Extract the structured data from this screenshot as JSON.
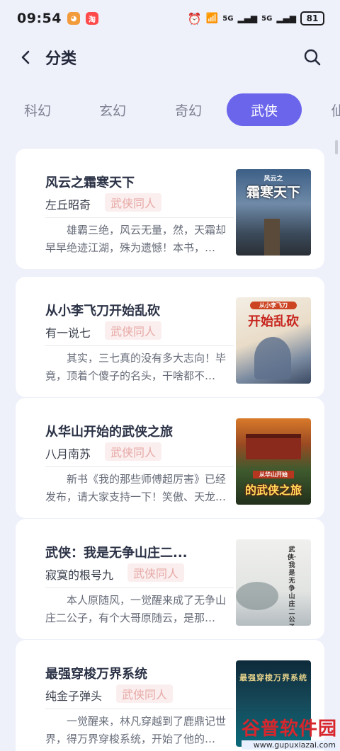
{
  "status_bar": {
    "time": "09:54",
    "sig1": "5G",
    "sig2": "5G",
    "battery": "81"
  },
  "header": {
    "title": "分类"
  },
  "tabs": [
    "科幻",
    "玄幻",
    "奇幻",
    "武侠",
    "仙"
  ],
  "active_tab": "武侠",
  "books": [
    {
      "title": "风云之霜寒天下",
      "author": "左丘昭奇",
      "tag": "武侠同人",
      "desc": "雄霸三绝，风云无量，然，天霜却早早绝迹江湖，殊为遗憾！本书，…",
      "cover_text": "霜寒天下",
      "cover_top": "风云之"
    },
    {
      "title": "从小李飞刀开始乱砍",
      "author": "有一说七",
      "tag": "武侠同人",
      "desc": "其实，三七真的没有多大志向！毕竟，顶着个傻子的名头，干啥都不…",
      "cover_text": "开始乱砍",
      "cover_top": "从小李飞刀"
    },
    {
      "title": "从华山开始的武侠之旅",
      "author": "八月南苏",
      "tag": "武侠同人",
      "desc": "新书《我的那些师傅超厉害》已经发布，请大家支持一下！笑傲、天龙…",
      "cover_text": "的武侠之旅",
      "cover_top": "从华山开始"
    },
    {
      "title": "武侠：我是无争山庄二...",
      "author": "寂寞的根号九",
      "tag": "武侠同人",
      "desc": "本人原随风，一觉醒来成了无争山庄二公子，有个大哥原随云，是那…",
      "cover_text": "武侠·我是无争山庄二公子",
      "cover_top": ""
    },
    {
      "title": "最强穿梭万界系统",
      "author": "纯金子弹头",
      "tag": "武侠同人",
      "desc": "一觉醒来，林凡穿越到了鹿鼎记世界，得万界穿梭系统，开始了他的…",
      "cover_text": "最强穿梭万界系统",
      "cover_top": ""
    }
  ],
  "watermark": {
    "main": "谷普软件园",
    "url": "www.gupuxiazai.com"
  },
  "colors": {
    "accent": "#6b65ec",
    "tag_bg": "#fbeeee",
    "tag_text": "#e6a9a6",
    "background": "#eef0fa"
  }
}
